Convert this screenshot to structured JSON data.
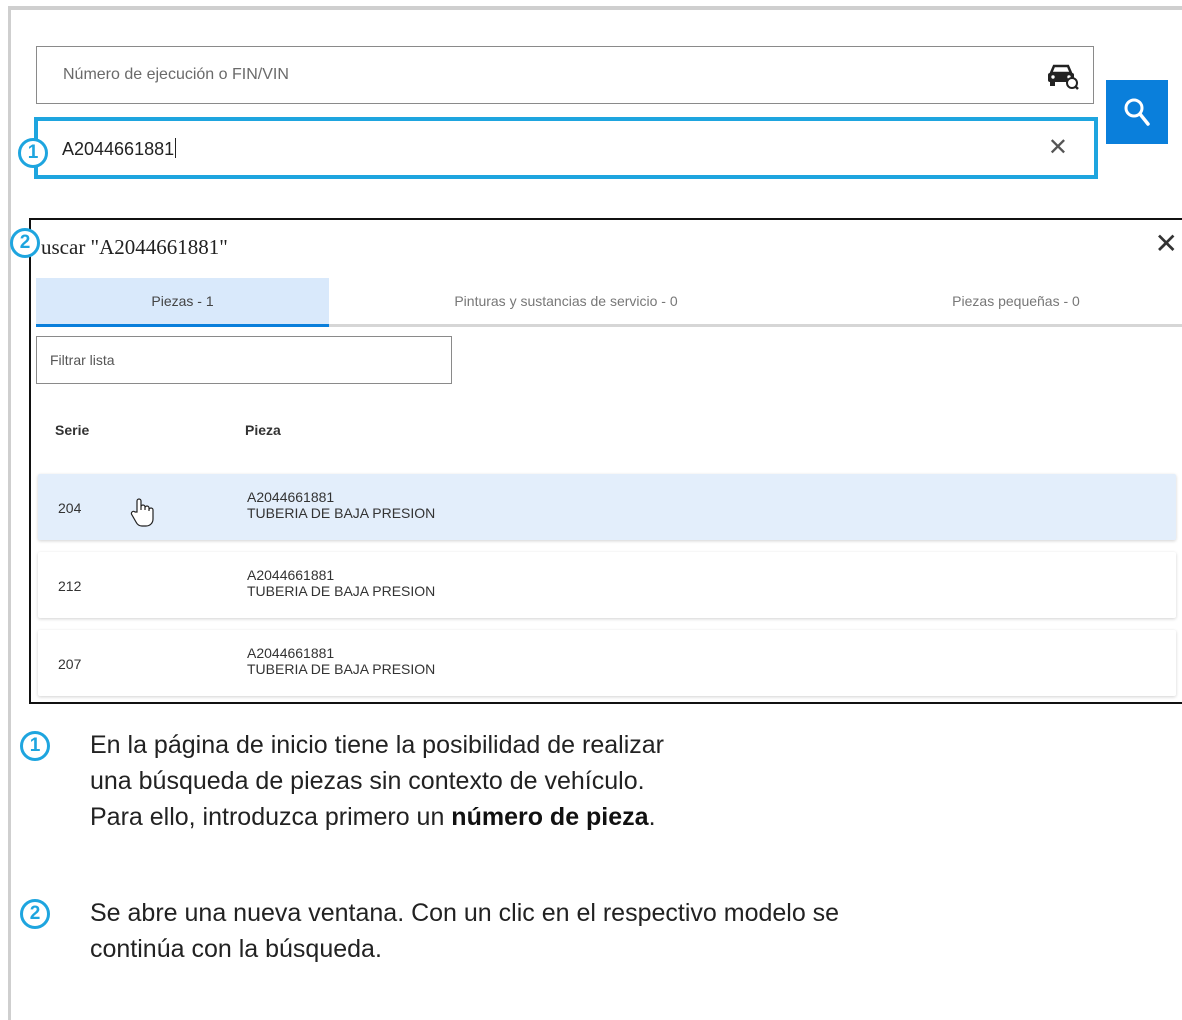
{
  "search": {
    "vin_placeholder": "Número de ejecución o FIN/VIN",
    "part_value": "A2044661881"
  },
  "badges": {
    "one": "1",
    "two": "2"
  },
  "modal": {
    "title": "uscar \"A2044661881\"",
    "tabs": [
      {
        "label": "Piezas - 1"
      },
      {
        "label": "Pinturas y sustancias de servicio - 0"
      },
      {
        "label": "Piezas pequeñas - 0"
      }
    ],
    "filter_placeholder": "Filtrar lista",
    "columns": {
      "series": "Serie",
      "part": "Pieza"
    },
    "rows": [
      {
        "series": "204",
        "number": "A2044661881",
        "desc": "TUBERIA DE BAJA PRESION"
      },
      {
        "series": "212",
        "number": "A2044661881",
        "desc": "TUBERIA DE BAJA PRESION"
      },
      {
        "series": "207",
        "number": "A2044661881",
        "desc": "TUBERIA DE BAJA PRESION"
      }
    ]
  },
  "notes": {
    "one_l1": "En la página de inicio tiene la posibilidad de realizar",
    "one_l2": "una búsqueda de piezas sin contexto de vehículo.",
    "one_l3a": "Para ello, introduzca primero un ",
    "one_l3b": "número de pieza",
    "one_l3c": ".",
    "two_l1": "Se abre una nueva ventana. Con un clic en el respectivo modelo se",
    "two_l2": "continúa con la búsqueda."
  },
  "colors": {
    "accent": "#1ea5df",
    "primary": "#0a7fdb",
    "row_hover": "#e3eefb"
  }
}
